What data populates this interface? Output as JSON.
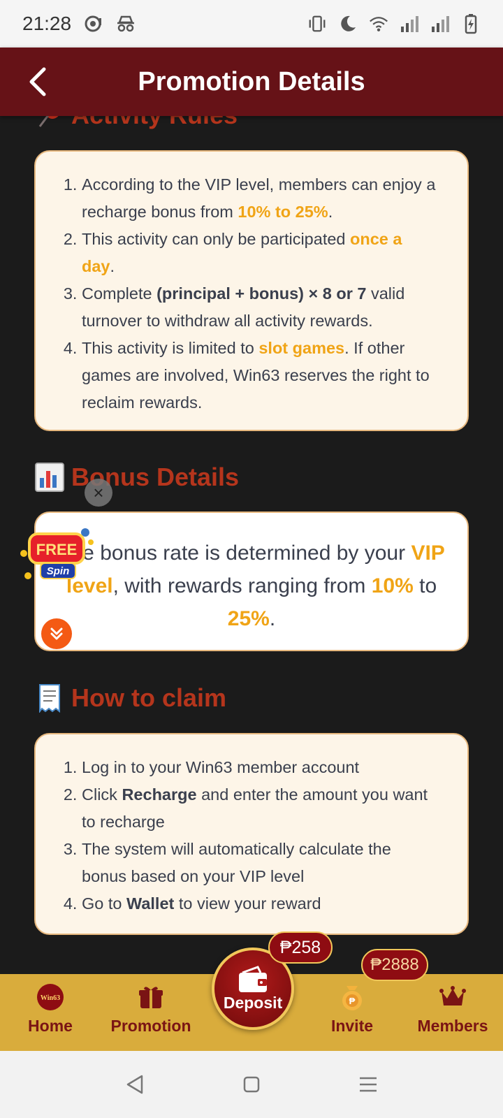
{
  "status_bar": {
    "time": "21:28",
    "icons": [
      "notification-bubble-icon",
      "incognito-icon",
      "vibrate-icon",
      "do-not-disturb-moon-icon",
      "wifi-icon",
      "signal-icon",
      "signal-icon",
      "battery-charging-icon"
    ]
  },
  "header": {
    "title": "Promotion Details",
    "back_icon": "chevron-left-icon"
  },
  "activity_rules": {
    "title": "Activity Rules",
    "icon": "pushpin-icon",
    "items": [
      {
        "before": "According to the VIP level, members can enjoy a recharge bonus from ",
        "highlight": "10% to 25%",
        "after": "."
      },
      {
        "before": "This activity can only be participated ",
        "highlight": "once a day",
        "after": "."
      },
      {
        "before": "Complete ",
        "bold": "(principal + bonus) × 8 or 7",
        "after": " valid turnover to withdraw all activity rewards."
      },
      {
        "before": "This activity is limited to ",
        "highlight": "slot games",
        "after": ". If other games are involved, Win63 reserves the right to reclaim rewards."
      }
    ]
  },
  "bonus_details": {
    "title": "Bonus Details",
    "icon": "bar-chart-icon",
    "text_before": "The bonus rate is determined by your ",
    "highlight_vip": "VIP level",
    "text_middle": ", with rewards ranging from ",
    "highlight_min": "10%",
    "text_to": " to ",
    "highlight_max": "25%",
    "text_end": "."
  },
  "how_to_claim": {
    "title": "How to claim",
    "icon": "receipt-icon",
    "items": [
      {
        "before": "Log in to your Win63 member account",
        "bold": "",
        "after": ""
      },
      {
        "before": "Click ",
        "bold": "Recharge",
        "after": " and enter the amount you want to recharge"
      },
      {
        "before": "The system will automatically calculate the bonus based on your VIP level",
        "bold": "",
        "after": ""
      },
      {
        "before": "Go to ",
        "bold": "Wallet",
        "after": " to view your reward"
      }
    ]
  },
  "floating": {
    "close_glyph": "×",
    "free_spin_top": "FREE",
    "free_spin_bottom": "Spin"
  },
  "bottom_nav": {
    "home": "Home",
    "home_logo": "Win63",
    "promotion": "Promotion",
    "deposit": "Deposit",
    "invite": "Invite",
    "members": "Members",
    "deposit_badge": "₱258",
    "invite_badge": "₱2888"
  },
  "colors": {
    "header": "#661217",
    "section_title": "#b5351c",
    "highlight": "#f0a416",
    "card_bg": "#fdf5e8",
    "nav_bg": "#d9ac3c"
  }
}
